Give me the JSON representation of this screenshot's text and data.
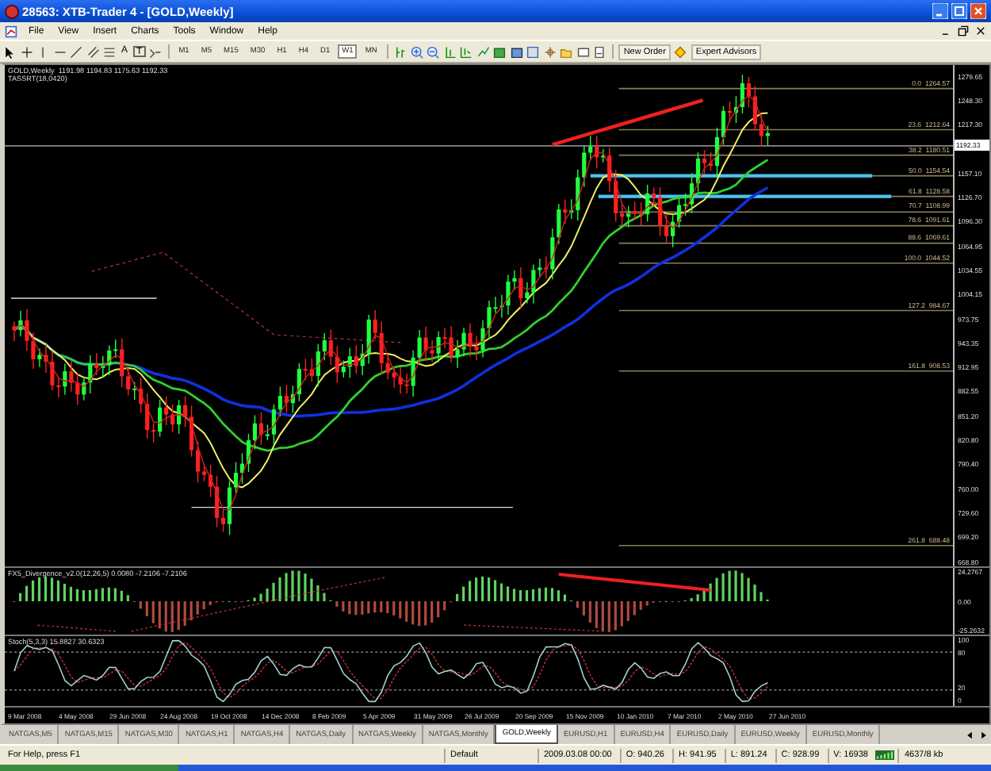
{
  "window": {
    "title": "28563: XTB-Trader 4 - [GOLD,Weekly]"
  },
  "menu": [
    "File",
    "View",
    "Insert",
    "Charts",
    "Tools",
    "Window",
    "Help"
  ],
  "toolbar": {
    "drawing_tools": [
      {
        "kind": "cursor"
      },
      {
        "kind": "crosshair"
      },
      {
        "kind": "vertical-line"
      },
      {
        "kind": "horizontal-line"
      },
      {
        "kind": "trendline"
      },
      {
        "kind": "channel"
      },
      {
        "kind": "fibonacci"
      },
      {
        "kind": "text",
        "label": "A"
      },
      {
        "kind": "text-box",
        "label": "T"
      },
      {
        "kind": "arrows"
      }
    ],
    "timeframes": [
      {
        "label": "M1",
        "selected": false
      },
      {
        "label": "M5",
        "selected": false
      },
      {
        "label": "M15",
        "selected": false
      },
      {
        "label": "M30",
        "selected": false
      },
      {
        "label": "H1",
        "selected": false
      },
      {
        "label": "H4",
        "selected": false
      },
      {
        "label": "D1",
        "selected": false
      },
      {
        "label": "W1",
        "selected": true
      },
      {
        "label": "MN",
        "selected": false
      }
    ],
    "chart_tools": [
      {
        "kind": "chart-type"
      },
      {
        "kind": "zoom-in"
      },
      {
        "kind": "zoom-out"
      },
      {
        "kind": "chart-shift"
      },
      {
        "kind": "autoscroll"
      },
      {
        "kind": "indicators"
      },
      {
        "kind": "new-chart"
      },
      {
        "kind": "templates"
      },
      {
        "kind": "market-watch"
      },
      {
        "kind": "navigator"
      },
      {
        "kind": "folder"
      },
      {
        "kind": "terminal"
      },
      {
        "kind": "tester"
      }
    ],
    "new_order": "New Order",
    "expert_advisors": "Expert Advisors"
  },
  "chart": {
    "header": "GOLD,Weekly  1191.98 1194.83 1175.63 1192.33",
    "indicator_label": "TASSRT(18,0420)",
    "price_axis": [
      "1279.65",
      "1248.30",
      "1217.30",
      "1157.10",
      "1126.70",
      "1096.30",
      "1064.95",
      "1034.55",
      "1004.15",
      "973.75",
      "943.35",
      "912.95",
      "882.55",
      "851.20",
      "820.80",
      "790.40",
      "760.00",
      "729.60",
      "699.20",
      "668.80"
    ],
    "current_price": "1192.33",
    "fib_levels": [
      {
        "level": "0.0",
        "price": "1264.57"
      },
      {
        "level": "23.6",
        "price": "1212.64"
      },
      {
        "level": "38.2",
        "price": "1180.51"
      },
      {
        "level": "50.0",
        "price": "1154.54"
      },
      {
        "level": "61.8",
        "price": "1128.58"
      },
      {
        "level": "70.7",
        "price": "1108.99"
      },
      {
        "level": "78.6",
        "price": "1091.61"
      },
      {
        "level": "88.6",
        "price": "1069.61"
      },
      {
        "level": "100.0",
        "price": "1044.52"
      },
      {
        "level": "127.2",
        "price": "984.67"
      },
      {
        "level": "161.8",
        "price": "908.53"
      },
      {
        "level": "261.8",
        "price": "688.48"
      }
    ],
    "divergence": {
      "label": "FX5_Divergence_v2.0(12,26,5) 0.0080 -7.2106 -7.2106",
      "axis": [
        "24.2767",
        "0.00",
        "-25.2632"
      ]
    },
    "stochastic": {
      "label": "Stoch(5,3,3) 15.8827 30.6323",
      "axis": [
        "100",
        "80",
        "20",
        "0"
      ]
    },
    "date_axis": [
      "9 Mar 2008",
      "4 May 2008",
      "29 Jun 2008",
      "24 Aug 2008",
      "19 Oct 2008",
      "14 Dec 2008",
      "8 Feb 2009",
      "5 Apr 2009",
      "31 May 2009",
      "26 Jul 2009",
      "20 Sep 2009",
      "15 Nov 2009",
      "10 Jan 2010",
      "7 Mar 2010",
      "2 May 2010",
      "27 Jun 2010"
    ]
  },
  "tabs": [
    {
      "label": "NATGAS,M5",
      "selected": false
    },
    {
      "label": "NATGAS,M15",
      "selected": false
    },
    {
      "label": "NATGAS,M30",
      "selected": false
    },
    {
      "label": "NATGAS,H1",
      "selected": false
    },
    {
      "label": "NATGAS,H4",
      "selected": false
    },
    {
      "label": "NATGAS,Daily",
      "selected": false
    },
    {
      "label": "NATGAS,Weekly",
      "selected": false
    },
    {
      "label": "NATGAS,Monthly",
      "selected": false
    },
    {
      "label": "GOLD,Weekly",
      "selected": true
    },
    {
      "label": "EURUSD,H1",
      "selected": false
    },
    {
      "label": "EURUSD,H4",
      "selected": false
    },
    {
      "label": "EURUSD,Daily",
      "selected": false
    },
    {
      "label": "EURUSD,Weekly",
      "selected": false
    },
    {
      "label": "EURUSD,Monthly",
      "selected": false
    }
  ],
  "status_bar": {
    "help": "For Help, press F1",
    "profile": "Default",
    "time": "2009.03.08 00:00",
    "open": "O: 940.26",
    "high": "H: 941.95",
    "low": "L: 891.24",
    "close": "C: 928.99",
    "volume": "V: 16938",
    "traffic": "4637/8 kb"
  }
}
